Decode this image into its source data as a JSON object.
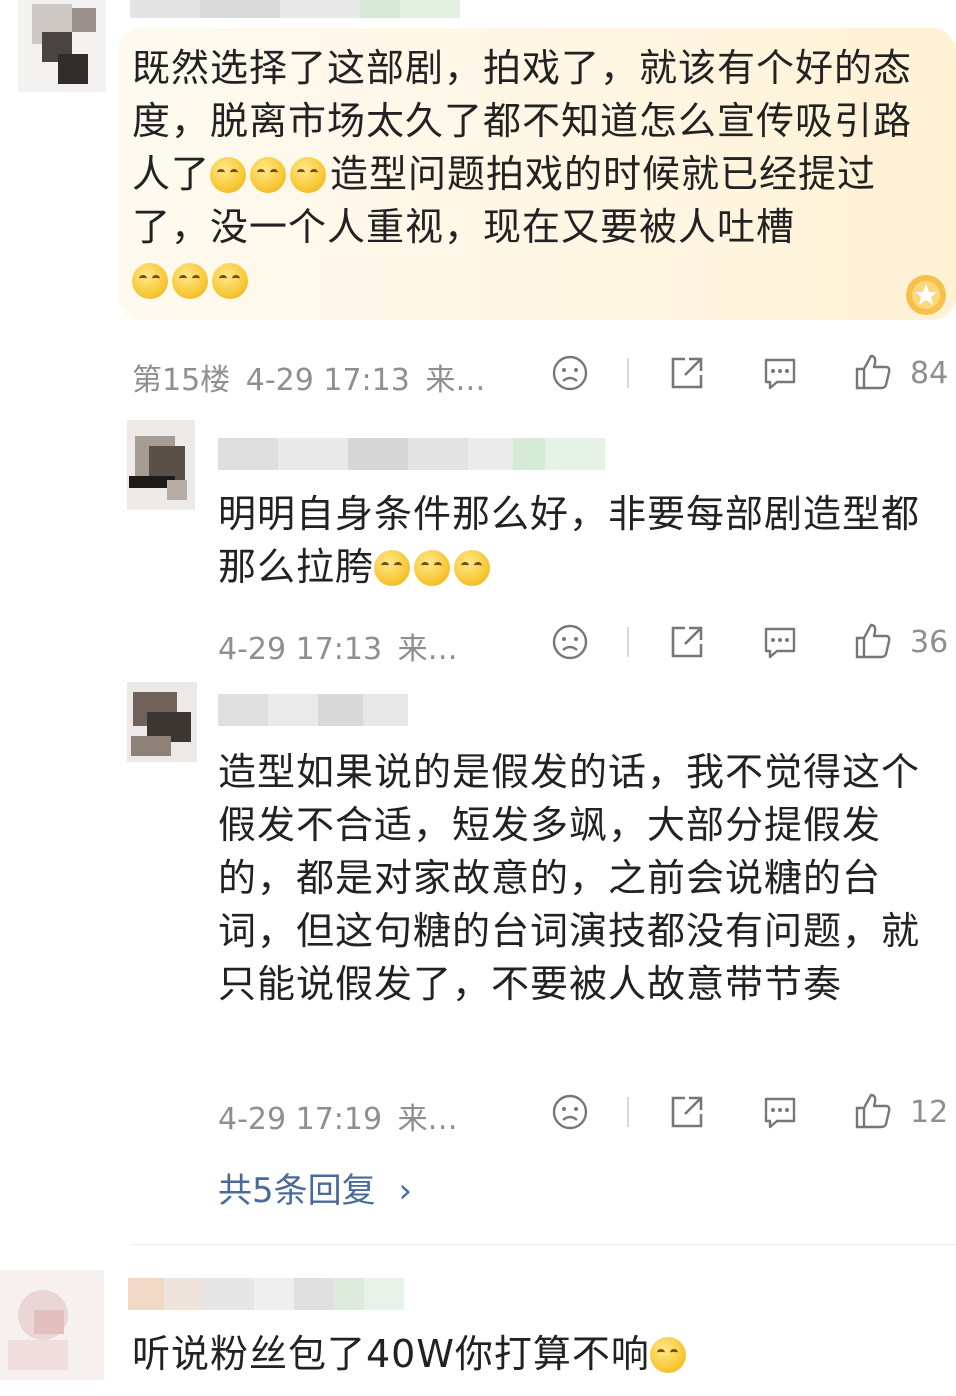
{
  "comments": [
    {
      "floor": "第15楼",
      "time": "4-29 17:13",
      "source": "来…",
      "text_parts": [
        "既然选择了这部剧，拍戏了，就该有个好的态度，脱离市场太久了都不知道怎么宣传吸引路人了",
        "造型问题拍戏的时候就已经提过了，没一个人重视，现在又要被人吐槽",
        ""
      ],
      "likes": "84"
    }
  ],
  "replies": [
    {
      "time": "4-29 17:13",
      "source": "来…",
      "text_parts": [
        "明明自身条件那么好，非要每部剧造型都那么拉胯",
        ""
      ],
      "likes": "36"
    },
    {
      "time": "4-29 17:19",
      "source": "来…",
      "text": "造型如果说的是假发的话，我不觉得这个假发不合适，短发多飒，大部分提假发的，都是对家故意的，之前会说糖的台词，但这句糖的台词演技都没有问题，就只能说假发了，不要被人故意带节奏",
      "likes": "12"
    }
  ],
  "more_replies": "共5条回复",
  "more_replies_chevron": "›",
  "next_comment": {
    "text": "听说粉丝包了40W你打算不响"
  },
  "colors": {
    "link": "#4a6a99",
    "meta": "#8f8f8f",
    "highlight": "#fff6e3",
    "badge": "#f6c04a"
  },
  "icons": [
    "face-icon",
    "share-icon",
    "comment-icon",
    "like-icon",
    "badge-icon",
    "emoji-icon"
  ]
}
